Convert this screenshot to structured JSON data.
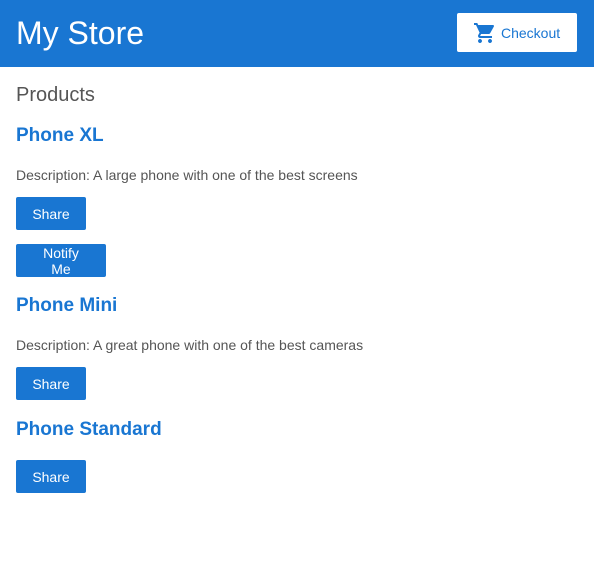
{
  "header": {
    "title": "My Store",
    "checkout_label": "Checkout",
    "checkout_icon": "shopping-cart-icon"
  },
  "main": {
    "section_title": "Products",
    "products": [
      {
        "name": "Phone XL",
        "description": "Description: A large phone with one of the best screens",
        "share_label": "Share",
        "notify_label": "Notify Me"
      },
      {
        "name": "Phone Mini",
        "description": "Description: A great phone with one of the best cameras",
        "share_label": "Share"
      },
      {
        "name": "Phone Standard",
        "share_label": "Share"
      }
    ]
  },
  "colors": {
    "primary": "#1976d2",
    "text": "#555555",
    "background": "#ffffff"
  }
}
